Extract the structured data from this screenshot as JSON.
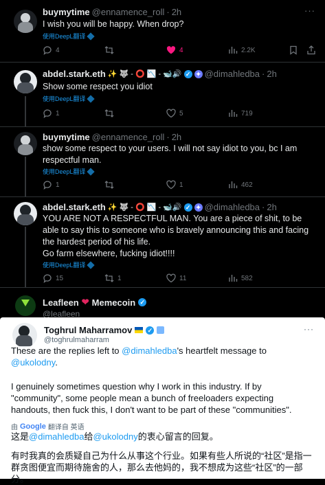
{
  "tweets": [
    {
      "name": "buymytime",
      "handle": "@ennamence_roll",
      "time": "2h",
      "text": "I wish you will be happy. When drop?",
      "translate": "使用DeepL翻译",
      "replies": "4",
      "retweets": "",
      "likes": "4",
      "views": "2.2K",
      "liked": true
    },
    {
      "name": "abdel.stark.eth",
      "handle": "@dimahledba",
      "time": "2h",
      "text": "Show some respect you idiot",
      "translate": "使用DeepL翻译",
      "replies": "1",
      "retweets": "",
      "likes": "5",
      "views": "719"
    },
    {
      "name": "buymytime",
      "handle": "@ennamence_roll",
      "time": "2h",
      "text": "show some respect to your users. I will not say idiot to you, bc I am respectful man.",
      "translate": "使用DeepL翻译",
      "replies": "1",
      "retweets": "",
      "likes": "1",
      "views": "462"
    },
    {
      "name": "abdel.stark.eth",
      "handle": "@dimahledba",
      "time": "2h",
      "text": "YOU ARE NOT A RESPECTFUL MAN. You are a piece of shit, to be able to say this to someone who is bravely announcing this and facing the hardest period of his life.",
      "text2": "Go farm elsewhere, fucking idiot!!!!",
      "translate": "使用DeepL翻译",
      "replies": "15",
      "retweets": "1",
      "likes": "11",
      "views": "582"
    }
  ],
  "abdel_emojis": "✨ 🐺 - ⭕ 📉 - 🐋🔊",
  "leafleen": {
    "name": "Leafleen",
    "name2": "Memecoin",
    "handle": "@leafleen"
  },
  "card": {
    "name": "Toghrul Maharramov",
    "handle": "@toghrulmaharram",
    "p1_a": "These are the replies left to ",
    "p1_m1": "@dimahledba",
    "p1_b": "'s heartfelt message to ",
    "p1_m2": "@ukolodny",
    "p1_c": ".",
    "p2": "I genuinely sometimes question why I work in this industry. If by \"community\", some people mean a bunch of freeloaders expecting handouts, then fuck this, I don't want to be part of these \"communities\".",
    "trans_by": "由",
    "trans_google": "Google",
    "trans_from": "翻译自 英语",
    "zh1_a": "这是",
    "zh1_m1": "@dimahledba",
    "zh1_b": "给",
    "zh1_m2": "@ukolodny",
    "zh1_c": "的衷心留言的回复。",
    "zh2": "有时我真的会质疑自己为什么从事这个行业。如果有些人所说的“社区”是指一群贪图便宜而期待施舍的人，那么去他妈的，我不想成为这些“社区”的一部分。"
  },
  "colors": {
    "accent": "#1d9bf0",
    "like": "#f91880",
    "muted": "#71767b"
  }
}
